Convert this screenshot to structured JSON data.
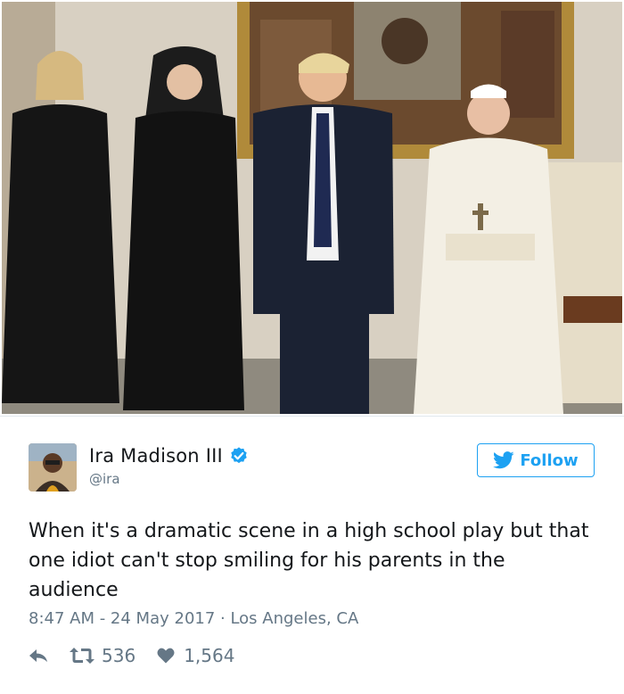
{
  "photo": {
    "icon": "photo-image"
  },
  "author": {
    "display_name": "Ira Madison III",
    "handle": "@ira",
    "verified": true,
    "avatar_icon": "avatar-image"
  },
  "follow": {
    "label": "Follow",
    "icon": "twitter-bird-icon",
    "color": "#1da1f2"
  },
  "tweet": {
    "text": "When it's a dramatic scene in a high school play but that one idiot can't stop smiling for his parents in the audience"
  },
  "meta": {
    "text": "8:47 AM - 24 May 2017 · Los Angeles, CA"
  },
  "actions": {
    "reply_icon": "reply-icon",
    "retweet_icon": "retweet-icon",
    "retweets": "536",
    "like_icon": "heart-icon",
    "likes": "1,564"
  }
}
